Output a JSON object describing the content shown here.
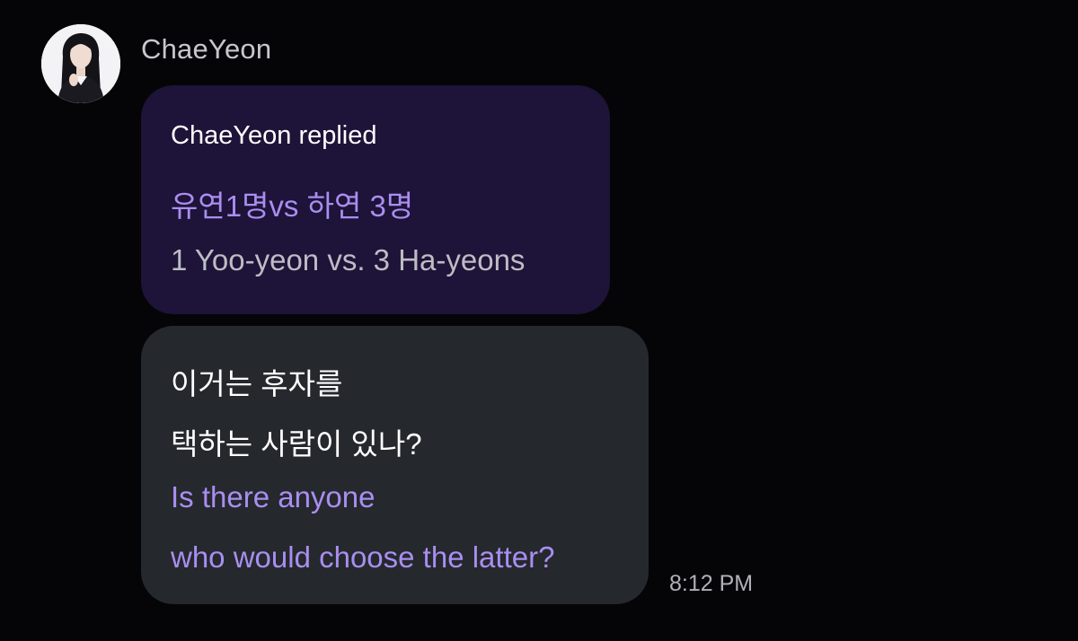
{
  "sender": {
    "name": "ChaeYeon",
    "avatar_icon": "profile-photo"
  },
  "reply": {
    "header": "ChaeYeon replied",
    "korean_text": "유연1명vs 하연 3명",
    "translation": "1 Yoo-yeon vs. 3 Ha-yeons"
  },
  "message": {
    "korean_lines": [
      "이거는 후자를",
      "택하는 사람이 있나?"
    ],
    "english_lines": [
      "Is there anyone",
      "who would choose the latter?"
    ],
    "timestamp": "8:12 PM"
  },
  "colors": {
    "background": "#050507",
    "reply_bubble": "#1e1338",
    "message_bubble": "#25282d",
    "accent_purple": "#a98ef0"
  }
}
